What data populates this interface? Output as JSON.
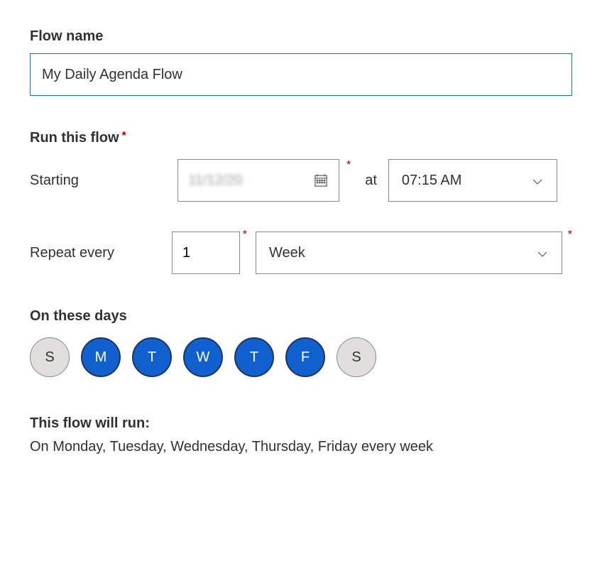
{
  "flowName": {
    "label": "Flow name",
    "value": "My Daily Agenda Flow"
  },
  "schedule": {
    "label": "Run this flow",
    "starting": {
      "label": "Starting",
      "dateValue": "11/12/20",
      "atLabel": "at",
      "timeValue": "07:15 AM"
    },
    "repeat": {
      "label": "Repeat every",
      "intervalValue": "1",
      "unitValue": "Week"
    }
  },
  "days": {
    "label": "On these days",
    "items": [
      {
        "abbr": "S",
        "selected": false
      },
      {
        "abbr": "M",
        "selected": true
      },
      {
        "abbr": "T",
        "selected": true
      },
      {
        "abbr": "W",
        "selected": true
      },
      {
        "abbr": "T",
        "selected": true
      },
      {
        "abbr": "F",
        "selected": true
      },
      {
        "abbr": "S",
        "selected": false
      }
    ]
  },
  "summary": {
    "label": "This flow will run:",
    "text": "On Monday, Tuesday, Wednesday, Thursday, Friday every week"
  },
  "asterisk": "*"
}
